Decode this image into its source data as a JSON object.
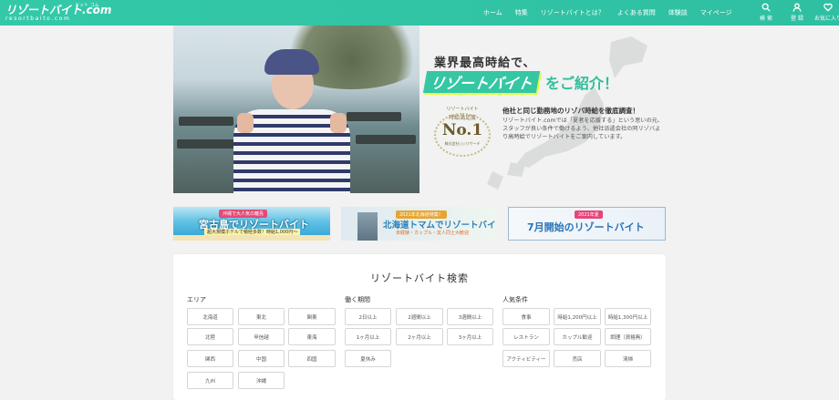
{
  "header": {
    "logo_main": "リゾートバイト.com",
    "logo_ruby": "ドット コム",
    "logo_sub": "resortbaito.com",
    "nav": [
      "ホーム",
      "特集",
      "リゾートバイトとは？",
      "よくある質問",
      "体験談",
      "マイページ"
    ],
    "icons": [
      {
        "icon": "search-icon",
        "label": "検 索"
      },
      {
        "icon": "user-icon",
        "label": "登 録"
      },
      {
        "icon": "heart-icon",
        "label": "お気に入り"
      }
    ]
  },
  "hero": {
    "headline_line1": "業界最高時給で、",
    "headline_brand": "リゾートバイト",
    "headline_rest": "をご紹介！",
    "badge_line1": "リゾートバイト",
    "badge_line2": "時給満足度",
    "badge_rank": "No.1",
    "badge_note": "株式会社○○リサーチ",
    "sub_title": "他社と同じ勤務地のリゾバ時給を徹底調査！",
    "description": "リゾートバイト.comでは「夏者を応援する」という思いの元、スタッフが良い条件で働けるよう、他社派遣会社の同リゾバより高時給でリゾートバイトをご案内しています。"
  },
  "banners": [
    {
      "tag": "沖縄で大人気の離島",
      "title": "宮古島でリゾートバイト",
      "sub": "超大規模ホテルで積極多数！時給1,000円〜"
    },
    {
      "tag": "2021年北海道特集！",
      "title": "北海道トマムでリゾートバイト",
      "sub": "未経験・カップル・友人同士大歓迎"
    },
    {
      "tag": "2021年夏",
      "title": "7月開始のリゾートバイト"
    }
  ],
  "search": {
    "title": "リゾートバイト検索",
    "area_label": "エリア",
    "area_options": [
      "北海道",
      "東北",
      "関東",
      "北陸",
      "甲信越",
      "東海",
      "関西",
      "中国",
      "四国",
      "九州",
      "沖縄"
    ],
    "period_label": "働く期間",
    "period_options": [
      "2日以上",
      "2週間以上",
      "3週間以上",
      "1ヶ月以上",
      "2ヶ月以上",
      "3ヶ月以上",
      "夏休み"
    ],
    "conditions_label": "人気条件",
    "condition_options": [
      "食事",
      "時給1,200円以上",
      "時給1,300円以上",
      "レストラン",
      "カップル歓迎",
      "調理（資格無）",
      "アクティビティー",
      "売店",
      "清掃"
    ]
  },
  "colors": {
    "brand": "#33c9a8",
    "accent_yellow": "#e5ff3d",
    "text": "#333333"
  }
}
